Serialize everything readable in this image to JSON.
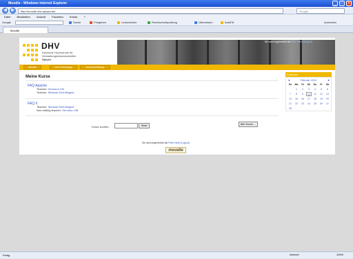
{
  "window": {
    "title": "Moodle - Windows Internet Explorer",
    "minimize_glyph": "_",
    "maximize_glyph": "□",
    "close_glyph": "×"
  },
  "browser": {
    "back_glyph": "◀",
    "forward_glyph": "▶",
    "address": "http://moodle.dhv-speyer.de/",
    "search_placeholder": "Google",
    "menu": [
      "Datei",
      "Bearbeiten",
      "Ansicht",
      "Favoriten",
      "Extras",
      "?"
    ],
    "google_label": "Google",
    "toolbar_items": [
      "Suche",
      "Freigeben",
      "Lesezeichen",
      "Rechtschreibprüfung",
      "Übersetzen",
      "AutoFill",
      "Anmelden"
    ],
    "tab_label": "Moodle",
    "status_text": "Fertig",
    "status_zone": "Internet",
    "zoom": "100%"
  },
  "site": {
    "logo_text": "DHV",
    "logo_sub1": "Deutsche Hochschule für",
    "logo_sub2": "Verwaltungswissenschaften",
    "logo_sub3": "Speyer",
    "top_login_prefix": "Sie sind angemeldet als",
    "top_login_user": "Peter Neth",
    "top_logout": "(Logout)",
    "nav": [
      "Moodle",
      "DHV-Homepage",
      "Hochschulleitung"
    ]
  },
  "main": {
    "heading": "Meine Kurse",
    "courses": [
      {
        "title": "FAQ Apache",
        "lines": [
          {
            "role": "Teacher:",
            "name": "Hermann Hill"
          },
          {
            "role": "Teacher:",
            "name": "Stefanie Moll-Wagner"
          }
        ]
      },
      {
        "title": "FAQ II",
        "lines": [
          {
            "role": "Teacher:",
            "name": "Stefanie Moll-Wagner"
          },
          {
            "role": "Non-editing teacher:",
            "name": "Hermann Hill"
          }
        ]
      }
    ],
    "search_label": "Kurse suchen:",
    "search_button": "Start",
    "all_courses_button": "Alle Kurse ..."
  },
  "calendar": {
    "title": "Kalender",
    "month": "Februar 2010",
    "prev": "◄",
    "next": "►",
    "day_names": [
      "So",
      "Mo",
      "Di",
      "Mi",
      "Do",
      "Fr",
      "Sa"
    ],
    "weeks": [
      [
        "",
        "1",
        "2",
        "3",
        "4",
        "5",
        "6"
      ],
      [
        "7",
        "8",
        "9",
        "10",
        "11",
        "12",
        "13"
      ],
      [
        "14",
        "15",
        "16",
        "17",
        "18",
        "19",
        "20"
      ],
      [
        "21",
        "22",
        "23",
        "24",
        "25",
        "26",
        "27"
      ],
      [
        "28",
        "",
        "",
        "",
        "",
        "",
        ""
      ]
    ],
    "today": "10"
  },
  "footer": {
    "login_prefix": "Sie sind angemeldet als",
    "login_user": "Peter Neth",
    "logout": "(Logout)",
    "moodle_logo": "moodle"
  }
}
